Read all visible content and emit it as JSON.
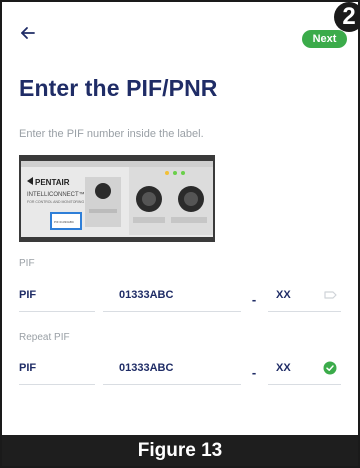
{
  "header": {
    "back_icon": "arrow-left-icon",
    "next_label": "Next",
    "badge_number": "2"
  },
  "page": {
    "title": "Enter the PIF/PNR",
    "instruction": "Enter the PIF number inside the label."
  },
  "device_photo": {
    "brand": "PENTAIR",
    "product": "INTELLICONNECT™",
    "subtitle": "FOR CONTROL AND MONITORING APP",
    "label_text": "PIF 01333ABC",
    "highlight_color": "#2f7fd8"
  },
  "pif_field": {
    "label": "PIF",
    "prefix": "PIF",
    "number": "01333ABC",
    "dash": "-",
    "check": "XX",
    "status_icon": "empty-badge-icon"
  },
  "repeat_field": {
    "label": "Repeat PIF",
    "prefix": "PIF",
    "number": "01333ABC",
    "dash": "-",
    "check": "XX",
    "status_icon": "check-circle-icon"
  },
  "figure_caption": "Figure 13",
  "colors": {
    "accent_green": "#3bab4a",
    "title_navy": "#1f2c66",
    "muted_text": "#9aa0a6"
  }
}
